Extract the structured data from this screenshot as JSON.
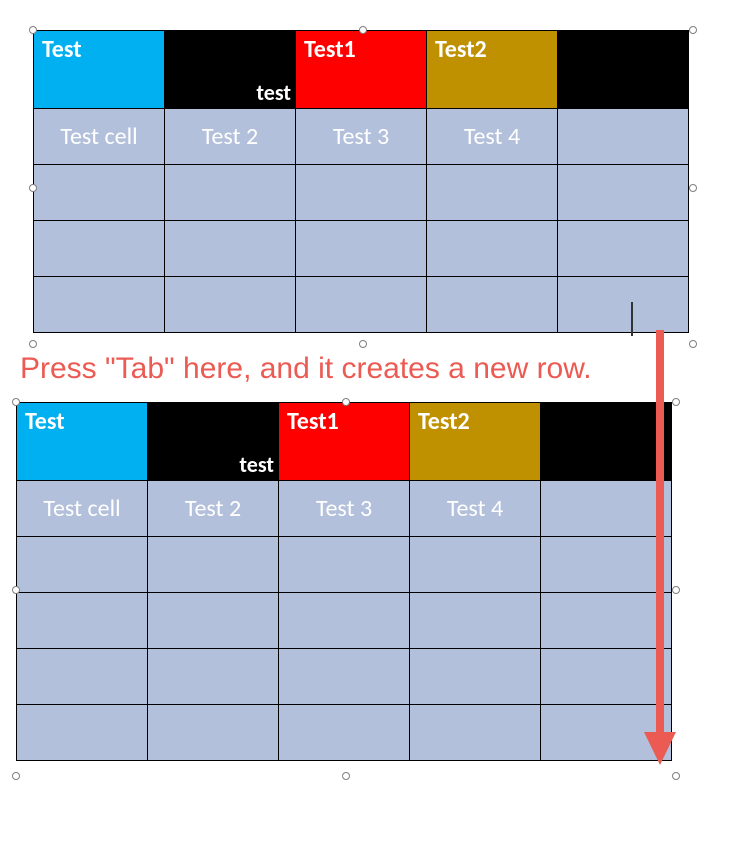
{
  "colors": {
    "blue": "#00b0f0",
    "red": "#ff0000",
    "gold": "#bf9000",
    "black": "#000000",
    "body": "#b3c0dc",
    "annot": "#eb5a53"
  },
  "table1": {
    "header": [
      {
        "top": "Test",
        "bottom": "",
        "fill": "blue"
      },
      {
        "top": "",
        "bottom": "test",
        "fill": "black"
      },
      {
        "top": "Test1",
        "bottom": "",
        "fill": "red"
      },
      {
        "top": "Test2",
        "bottom": "",
        "fill": "gold"
      },
      {
        "top": "",
        "bottom": "",
        "fill": "black"
      }
    ],
    "rows": [
      [
        "Test cell",
        "Test 2",
        "Test 3",
        "Test 4",
        ""
      ],
      [
        "",
        "",
        "",
        "",
        ""
      ],
      [
        "",
        "",
        "",
        "",
        ""
      ],
      [
        "",
        "",
        "",
        "",
        ""
      ]
    ]
  },
  "table2": {
    "header": [
      {
        "top": "Test",
        "bottom": "",
        "fill": "blue"
      },
      {
        "top": "",
        "bottom": "test",
        "fill": "black"
      },
      {
        "top": "Test1",
        "bottom": "",
        "fill": "red"
      },
      {
        "top": "Test2",
        "bottom": "",
        "fill": "gold"
      },
      {
        "top": "",
        "bottom": "",
        "fill": "black"
      }
    ],
    "rows": [
      [
        "Test cell",
        "Test 2",
        "Test 3",
        "Test 4",
        ""
      ],
      [
        "",
        "",
        "",
        "",
        ""
      ],
      [
        "",
        "",
        "",
        "",
        ""
      ],
      [
        "",
        "",
        "",
        "",
        ""
      ],
      [
        "",
        "",
        "",
        "",
        ""
      ]
    ]
  },
  "annotation": "Press \"Tab\" here, and it creates a new row."
}
